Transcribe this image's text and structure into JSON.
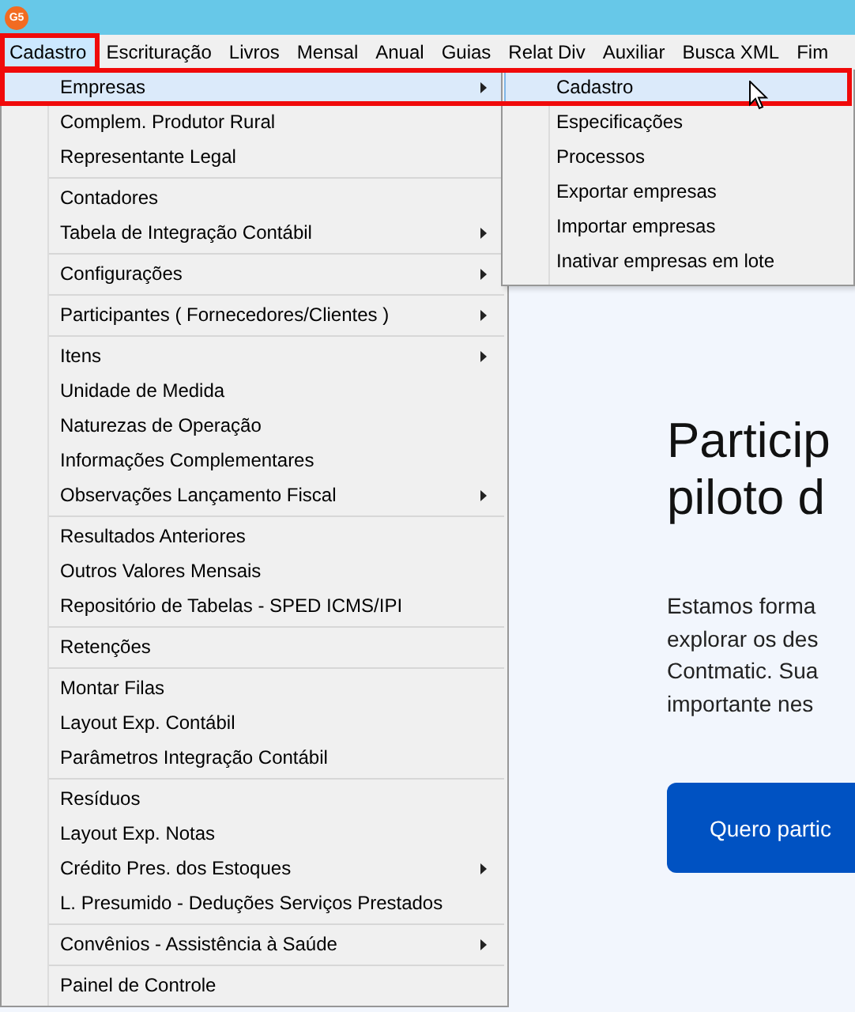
{
  "window": {
    "logo_text": "G5"
  },
  "menubar": [
    {
      "label": "Cadastro",
      "selected": true
    },
    {
      "label": "Escrituração",
      "selected": false
    },
    {
      "label": "Livros",
      "selected": false
    },
    {
      "label": "Mensal",
      "selected": false
    },
    {
      "label": "Anual",
      "selected": false
    },
    {
      "label": "Guias",
      "selected": false
    },
    {
      "label": "Relat Div",
      "selected": false
    },
    {
      "label": "Auxiliar",
      "selected": false
    },
    {
      "label": "Busca XML",
      "selected": false
    },
    {
      "label": "Fim",
      "selected": false
    }
  ],
  "menu_groups": [
    [
      {
        "label": "Empresas",
        "submenu": true,
        "selected": true
      },
      {
        "label": "Complem. Produtor Rural",
        "submenu": false,
        "selected": false
      },
      {
        "label": "Representante Legal",
        "submenu": false,
        "selected": false
      }
    ],
    [
      {
        "label": "Contadores",
        "submenu": false,
        "selected": false
      },
      {
        "label": "Tabela de Integração Contábil",
        "submenu": true,
        "selected": false
      }
    ],
    [
      {
        "label": "Configurações",
        "submenu": true,
        "selected": false
      }
    ],
    [
      {
        "label": "Participantes ( Fornecedores/Clientes )",
        "submenu": true,
        "selected": false
      }
    ],
    [
      {
        "label": "Itens",
        "submenu": true,
        "selected": false
      },
      {
        "label": "Unidade de Medida",
        "submenu": false,
        "selected": false
      },
      {
        "label": "Naturezas de Operação",
        "submenu": false,
        "selected": false
      },
      {
        "label": "Informações Complementares",
        "submenu": false,
        "selected": false
      },
      {
        "label": "Observações Lançamento Fiscal",
        "submenu": true,
        "selected": false
      }
    ],
    [
      {
        "label": "Resultados Anteriores",
        "submenu": false,
        "selected": false
      },
      {
        "label": "Outros Valores Mensais",
        "submenu": false,
        "selected": false
      },
      {
        "label": "Repositório de Tabelas - SPED ICMS/IPI",
        "submenu": false,
        "selected": false
      }
    ],
    [
      {
        "label": "Retenções",
        "submenu": false,
        "selected": false
      }
    ],
    [
      {
        "label": "Montar Filas",
        "submenu": false,
        "selected": false
      },
      {
        "label": "Layout Exp. Contábil",
        "submenu": false,
        "selected": false
      },
      {
        "label": "Parâmetros Integração Contábil",
        "submenu": false,
        "selected": false
      }
    ],
    [
      {
        "label": "Resíduos",
        "submenu": false,
        "selected": false
      },
      {
        "label": "Layout Exp. Notas",
        "submenu": false,
        "selected": false
      },
      {
        "label": "Crédito Pres. dos Estoques",
        "submenu": true,
        "selected": false
      },
      {
        "label": "L. Presumido - Deduções Serviços Prestados",
        "submenu": false,
        "selected": false
      }
    ],
    [
      {
        "label": "Convênios - Assistência à Saúde",
        "submenu": true,
        "selected": false
      }
    ],
    [
      {
        "label": "Painel de Controle",
        "submenu": false,
        "selected": false
      }
    ]
  ],
  "submenu": [
    {
      "label": "Cadastro",
      "selected": true
    },
    {
      "label": "Especificações",
      "selected": false
    },
    {
      "label": "Processos",
      "selected": false
    },
    {
      "label": "Exportar empresas",
      "selected": false
    },
    {
      "label": "Importar empresas",
      "selected": false
    },
    {
      "label": "Inativar empresas em lote",
      "selected": false
    }
  ],
  "page": {
    "heading": [
      "Particip",
      "piloto d"
    ],
    "paragraph": [
      "Estamos forma",
      "explorar os des",
      "Contmatic. Sua",
      "importante nes"
    ],
    "button": "Quero partic"
  }
}
